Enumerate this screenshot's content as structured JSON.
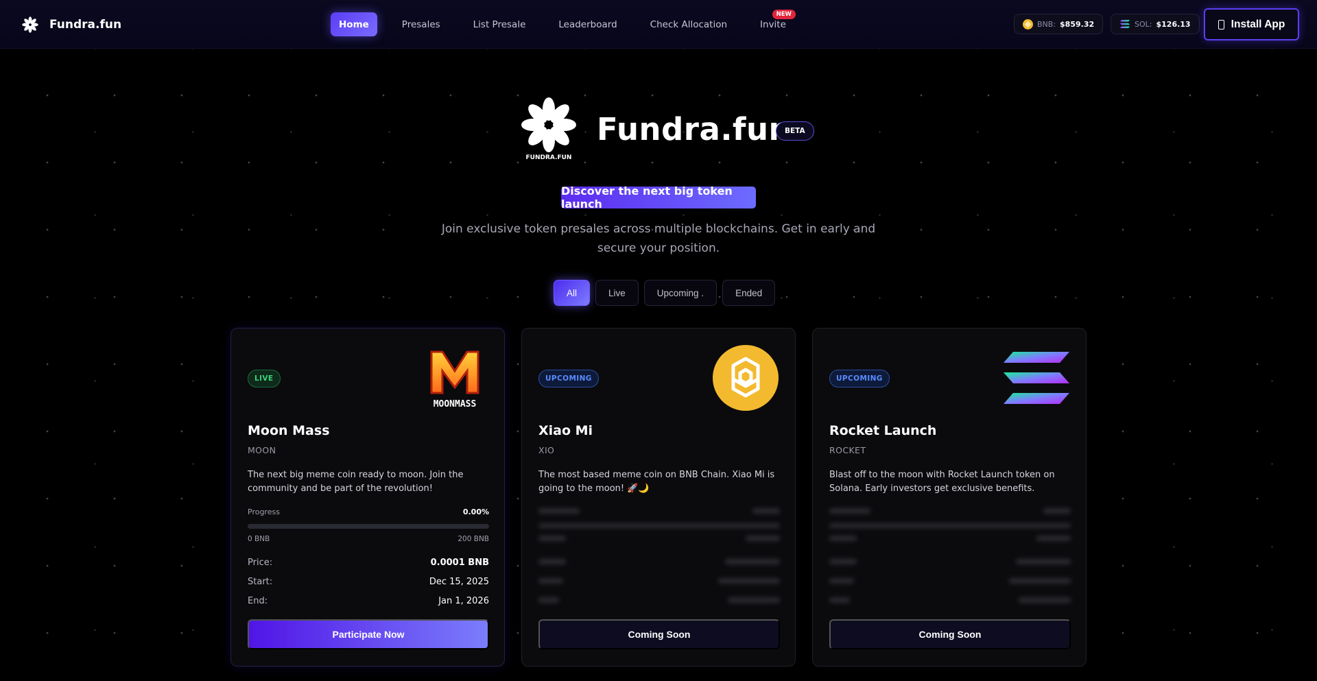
{
  "colors": {
    "accent": "#6b5cff",
    "live": "#3fd07a",
    "upcoming": "#5b8bff",
    "bnb": "#f3ba2f",
    "badge_new": "#e2253b"
  },
  "brand": {
    "name": "Fundra.fun",
    "logo_icon": "flower-logo-icon"
  },
  "nav": {
    "items": [
      {
        "label": "Home",
        "active": true
      },
      {
        "label": "Presales"
      },
      {
        "label": "List Presale"
      },
      {
        "label": "Leaderboard"
      },
      {
        "label": "Check Allocation"
      },
      {
        "label": "Invite",
        "badge": "NEW"
      }
    ]
  },
  "prices": {
    "bnb": {
      "label": "BNB:",
      "value": "$859.32",
      "icon": "bnb-coin-icon"
    },
    "sol": {
      "label": "SOL:",
      "value": "$126.13",
      "icon": "solana-icon"
    }
  },
  "install": {
    "label": "Install App",
    "icon": "phone-icon"
  },
  "hero": {
    "logo_caption": "FUNDRA.FUN",
    "title": "Fundra.fun",
    "beta": "BETA",
    "tagline": "Discover the next big token launch",
    "subtitle_line1": "Join exclusive token presales across multiple blockchains. Get in early and",
    "subtitle_line2": "secure your position."
  },
  "filters": [
    {
      "label": "All",
      "active": true
    },
    {
      "label": "Live"
    },
    {
      "label": "Upcoming ."
    },
    {
      "label": "Ended"
    }
  ],
  "cards": [
    {
      "status": "LIVE",
      "logo_text": "MOONMASS",
      "logo_icon": "moonmass-logo-icon",
      "name": "Moon Mass",
      "symbol": "MOON",
      "description": "The next big meme coin ready to moon. Join the community and be part of the revolution!",
      "progress_label": "Progress",
      "progress_value": "0.00%",
      "progress_fraction": 0.0,
      "range_min": "0 BNB",
      "range_max": "200 BNB",
      "price_label": "Price:",
      "price": "0.0001 BNB",
      "start_label": "Start:",
      "start": "Dec 15, 2025",
      "end_label": "End:",
      "end": "Jan 1, 2026",
      "cta": "Participate Now"
    },
    {
      "status": "UPCOMING",
      "logo_icon": "bnb-chain-logo-icon",
      "name": "Xiao Mi",
      "symbol": "XIO",
      "description": "The most based meme coin on BNB Chain. Xiao Mi is going to the moon! 🚀🌙",
      "cta": "Coming Soon"
    },
    {
      "status": "UPCOMING",
      "logo_icon": "solana-logo-icon",
      "name": "Rocket Launch",
      "symbol": "ROCKET",
      "description": "Blast off to the moon with Rocket Launch token on Solana. Early investors get exclusive benefits.",
      "cta": "Coming Soon"
    }
  ]
}
